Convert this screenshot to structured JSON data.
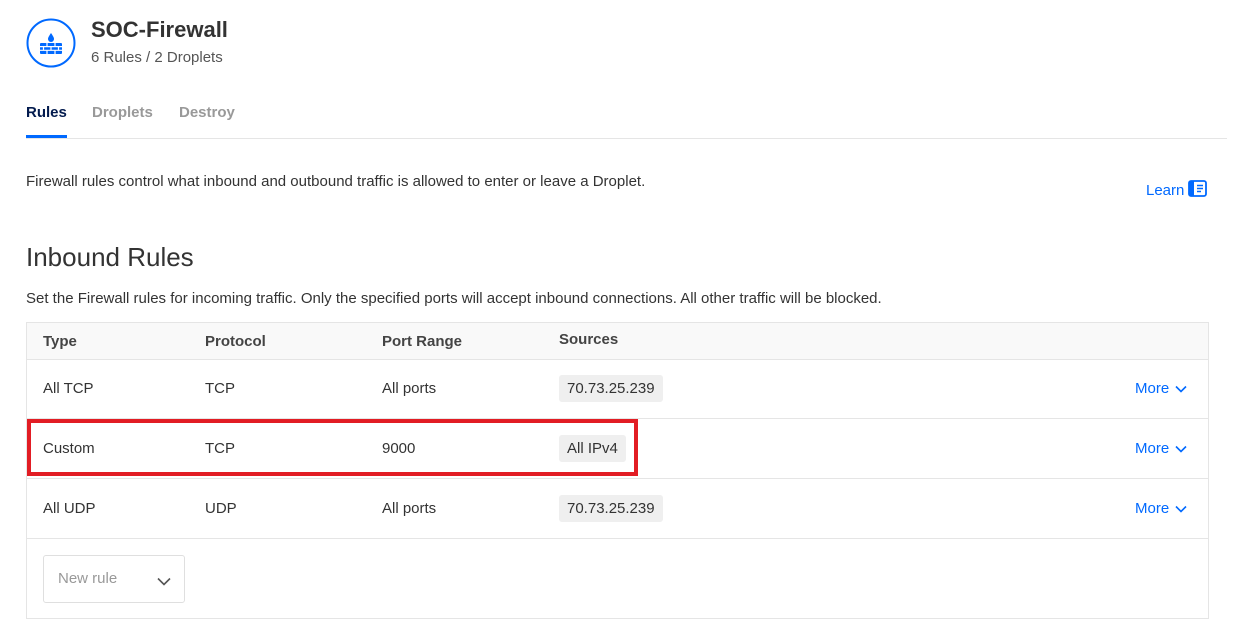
{
  "header": {
    "title": "SOC-Firewall",
    "subtitle": "6 Rules / 2 Droplets",
    "icon": "firewall-icon"
  },
  "tabs": [
    {
      "label": "Rules",
      "active": true
    },
    {
      "label": "Droplets",
      "active": false
    },
    {
      "label": "Destroy",
      "active": false
    }
  ],
  "description": "Firewall rules control what inbound and outbound traffic is allowed to enter or leave a Droplet.",
  "learn": {
    "label": "Learn",
    "icon": "document-icon"
  },
  "inbound": {
    "title": "Inbound Rules",
    "description": "Set the Firewall rules for incoming traffic. Only the specified ports will accept inbound connections. All other traffic will be blocked.",
    "columns": [
      "Type",
      "Protocol",
      "Port Range",
      "Sources"
    ],
    "rows": [
      {
        "type": "All TCP",
        "protocol": "TCP",
        "port_range": "All ports",
        "source": "70.73.25.239",
        "more": "More"
      },
      {
        "type": "Custom",
        "protocol": "TCP",
        "port_range": "9000",
        "source": "All IPv4",
        "more": "More"
      },
      {
        "type": "All UDP",
        "protocol": "UDP",
        "port_range": "All ports",
        "source": "70.73.25.239",
        "more": "More"
      }
    ],
    "new_rule": {
      "label": "New rule"
    }
  },
  "colors": {
    "accent": "#0069ff",
    "highlight": "#e21d24",
    "active_tab": "#031b4e"
  }
}
